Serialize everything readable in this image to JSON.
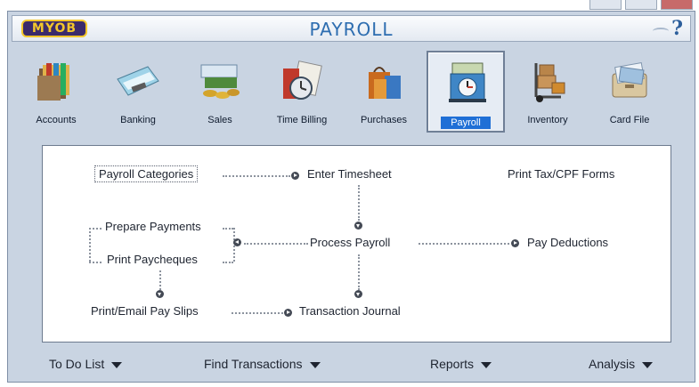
{
  "window": {
    "logo_text": "MYOB",
    "title": "PAYROLL",
    "help_glyph": "?"
  },
  "modules": [
    {
      "label": "Accounts",
      "icon": "folders-icon",
      "active": false
    },
    {
      "label": "Banking",
      "icon": "cheque-icon",
      "active": false
    },
    {
      "label": "Sales",
      "icon": "invoice-coins-icon",
      "active": false
    },
    {
      "label": "Time Billing",
      "icon": "stopwatch-icon",
      "active": false
    },
    {
      "label": "Purchases",
      "icon": "shopping-bags-icon",
      "active": false
    },
    {
      "label": "Payroll",
      "icon": "time-clock-icon",
      "active": true
    },
    {
      "label": "Inventory",
      "icon": "hand-truck-icon",
      "active": false
    },
    {
      "label": "Card File",
      "icon": "card-file-icon",
      "active": false
    }
  ],
  "flow": {
    "payroll_categories": "Payroll Categories",
    "enter_timesheet": "Enter Timesheet",
    "print_tax_forms": "Print Tax/CPF Forms",
    "prepare_payments": "Prepare Payments",
    "print_paycheques": "Print Paycheques",
    "process_payroll": "Process Payroll",
    "pay_deductions": "Pay Deductions",
    "print_email_slips": "Print/Email Pay Slips",
    "transaction_journal": "Transaction Journal"
  },
  "bottom": {
    "todo": "To Do List",
    "find": "Find Transactions",
    "reports": "Reports",
    "analysis": "Analysis"
  },
  "colors": {
    "frame": "#c9d4e2",
    "title_text": "#2d6db0",
    "active_label": "#1f6fd6",
    "logo_bg": "#3b2a6b",
    "logo_text": "#f3c62b"
  }
}
